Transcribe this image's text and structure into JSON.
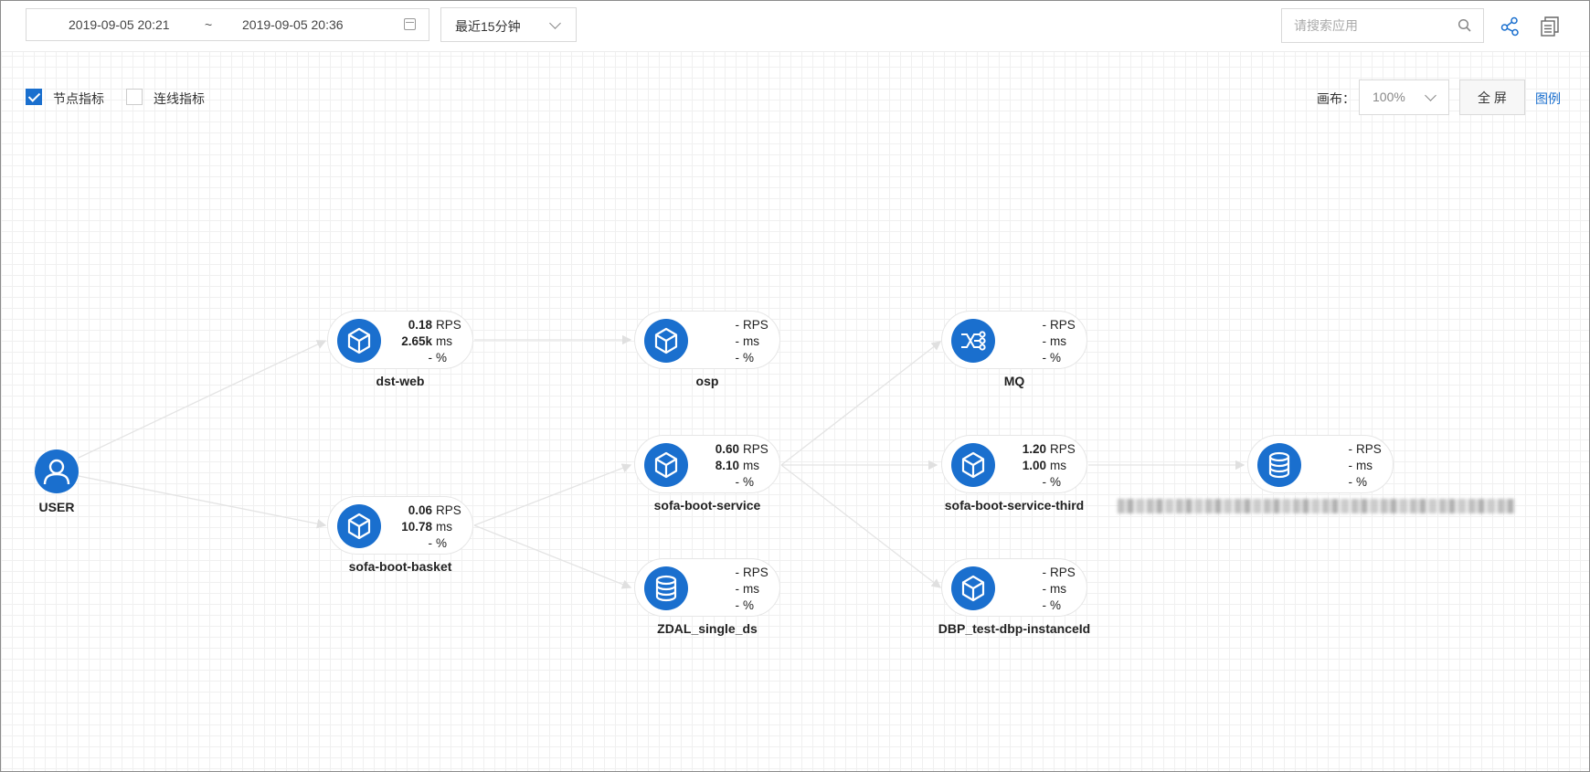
{
  "toolbar": {
    "start_time": "2019-09-05 20:21",
    "separator": "~",
    "end_time": "2019-09-05 20:36",
    "range_select": "最近15分钟",
    "search_placeholder": "请搜索应用"
  },
  "options": {
    "node_metrics_label": "节点指标",
    "node_metrics_checked": true,
    "link_metrics_label": "连线指标",
    "link_metrics_checked": false,
    "canvas_label": "画布：",
    "zoom": "100%",
    "fullscreen_label": "全 屏",
    "legend_label": "图例"
  },
  "accent_color": "#1a6fce",
  "user_node": {
    "label": "USER",
    "icon": "user-icon"
  },
  "nodes": [
    {
      "id": "dst-web",
      "label": "dst-web",
      "icon": "cube-icon",
      "rps": "0.18",
      "ms": "2.65k",
      "pct": "-",
      "bold": true
    },
    {
      "id": "osp",
      "label": "osp",
      "icon": "cube-icon",
      "rps": "-",
      "ms": "-",
      "pct": "-",
      "bold": false
    },
    {
      "id": "mq",
      "label": "MQ",
      "icon": "message-queue-icon",
      "rps": "-",
      "ms": "-",
      "pct": "-",
      "bold": false
    },
    {
      "id": "sofa-boot-service",
      "label": "sofa-boot-service",
      "icon": "cube-icon",
      "rps": "0.60",
      "ms": "8.10",
      "pct": "-",
      "bold": true
    },
    {
      "id": "sofa-boot-service-third",
      "label": "sofa-boot-service-third",
      "icon": "cube-icon",
      "rps": "1.20",
      "ms": "1.00",
      "pct": "-",
      "bold": true
    },
    {
      "id": "database",
      "label": "",
      "icon": "database-icon",
      "rps": "-",
      "ms": "-",
      "pct": "-",
      "bold": false
    },
    {
      "id": "sofa-boot-basket",
      "label": "sofa-boot-basket",
      "icon": "cube-icon",
      "rps": "0.06",
      "ms": "10.78",
      "pct": "-",
      "bold": true
    },
    {
      "id": "zdal-single-ds",
      "label": "ZDAL_single_ds",
      "icon": "database-icon",
      "rps": "-",
      "ms": "-",
      "pct": "-",
      "bold": false
    },
    {
      "id": "dbp-test-dbp-instanceid",
      "label": "DBP_test-dbp-instanceId",
      "icon": "cube-icon",
      "rps": "-",
      "ms": "-",
      "pct": "-",
      "bold": false
    }
  ],
  "units": {
    "rps": "RPS",
    "ms": "ms",
    "pct": "%"
  }
}
